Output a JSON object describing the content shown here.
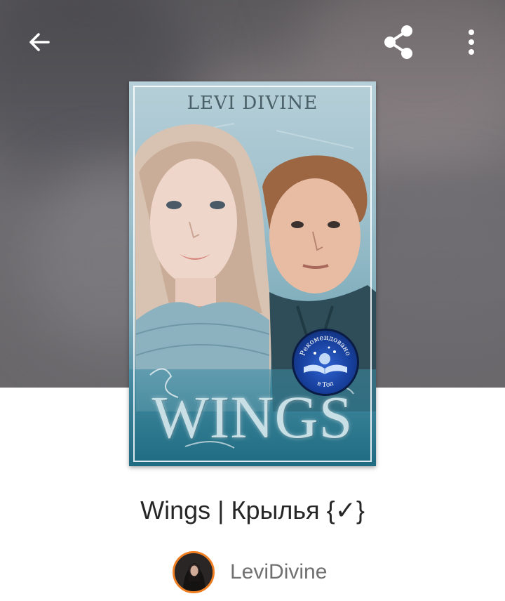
{
  "toolbar": {
    "back_icon": "arrow-left-icon",
    "share_icon": "share-icon",
    "more_icon": "more-vertical-icon"
  },
  "cover": {
    "author_text": "LEVI DIVINE",
    "title_text": "WINGS",
    "badge_text_top": "Рекомендовано",
    "badge_text_bottom": "в Топ"
  },
  "story": {
    "title": "Wings | Крылья {✓}",
    "author_name": "LeviDivine"
  },
  "colors": {
    "avatar_ring": "#f07f23",
    "title_text": "#262626",
    "author_text": "#707070"
  }
}
